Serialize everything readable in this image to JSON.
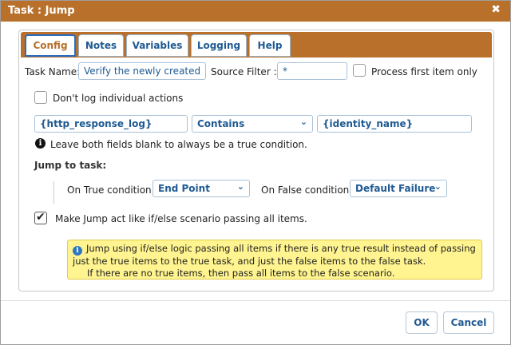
{
  "dialog": {
    "title": "Task : Jump",
    "close_icon": "close-icon"
  },
  "tabs": [
    {
      "label": "Config",
      "active": true
    },
    {
      "label": "Notes",
      "active": false
    },
    {
      "label": "Variables",
      "active": false
    },
    {
      "label": "Logging",
      "active": false
    },
    {
      "label": "Help",
      "active": false
    }
  ],
  "task_name": {
    "label": "Task Name:",
    "value": "Verify the newly created"
  },
  "source_filter": {
    "label": "Source Filter :",
    "value": "*"
  },
  "process_first": {
    "label": "Process first item only",
    "checked": false
  },
  "dont_log": {
    "label": "Don't log individual actions",
    "checked": false
  },
  "condition": {
    "left_value": "{http_response_log}",
    "operator": "Contains",
    "right_value": "{identity_name}",
    "hint": "Leave both fields blank to always be a true condition."
  },
  "jump": {
    "heading": "Jump to task:",
    "true_label": "On True condition:",
    "true_value": "End Point",
    "false_label": "On False condition:",
    "false_value": "Default Failure"
  },
  "ifelse": {
    "label": "Make Jump act like if/else scenario passing all items.",
    "checked": true
  },
  "notice": {
    "line1": "Jump using if/else logic passing all items if there is any true result instead of passing",
    "line2": "just the true items to the true task, and just the false items to the false task.",
    "line3": "If there are no true items, then pass all items to the false scenario."
  },
  "buttons": {
    "ok": "OK",
    "cancel": "Cancel"
  },
  "colors": {
    "accent": "#b8702a",
    "link": "#1f5a92",
    "notice_bg": "#fff48f"
  }
}
